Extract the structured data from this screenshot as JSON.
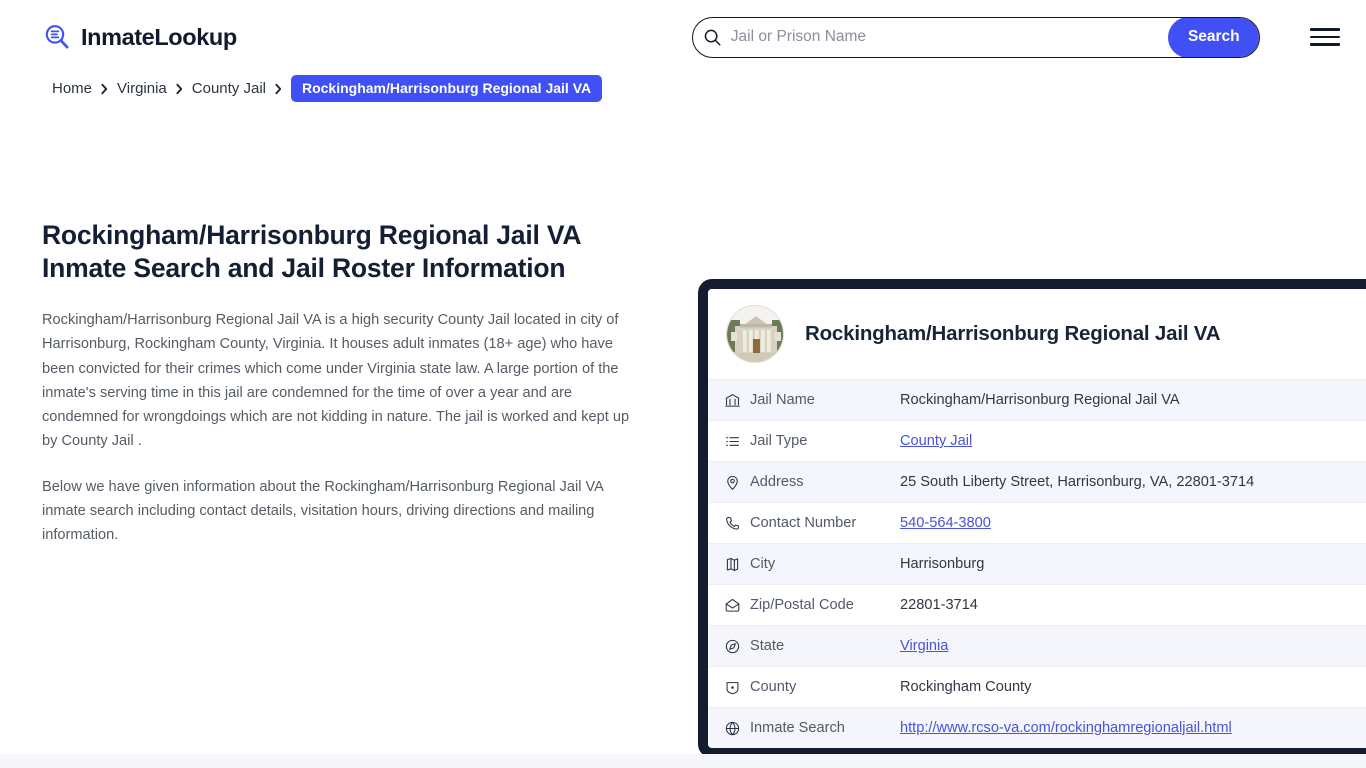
{
  "header": {
    "brand_name": "InmateLookup",
    "brand_icon": "magnifier-list-logo-icon",
    "search": {
      "placeholder": "Jail or Prison Name",
      "value": "",
      "icon": "search-icon",
      "button_label": "Search"
    },
    "menu_icon": "hamburger-menu-icon",
    "accent_color": "#4050f5"
  },
  "breadcrumb": {
    "items": [
      {
        "label": "Home",
        "current": false
      },
      {
        "label": "Virginia",
        "current": false
      },
      {
        "label": "County Jail",
        "current": false
      },
      {
        "label": "Rockingham/Harrisonburg Regional Jail VA",
        "current": true
      }
    ],
    "separator_icon": "chevron-right-icon"
  },
  "main": {
    "page_title": "Rockingham/Harrisonburg Regional Jail VA Inmate Search and Jail Roster Information",
    "paragraph_1": "Rockingham/Harrisonburg Regional Jail VA is a high security County Jail located in city of Harrisonburg, Rockingham County, Virginia. It houses adult inmates (18+ age) who have been convicted for their crimes which come under Virginia state law. A large portion of the inmate's serving time in this jail are condemned for the time of over a year and are condemned for wrongdoings which are not kidding in nature. The jail is worked and kept up by County Jail .",
    "paragraph_2": "Below we have given information about the Rockingham/Harrisonburg Regional Jail VA inmate search including contact details, visitation hours, driving directions and mailing information."
  },
  "card": {
    "photo_icon": "courthouse-building-photo",
    "title": "Rockingham/Harrisonburg Regional Jail VA",
    "border_color": "#141d2f",
    "rows": [
      {
        "icon": "bank-building-icon",
        "label": "Jail Name",
        "value": "Rockingham/Harrisonburg Regional Jail VA",
        "link": false
      },
      {
        "icon": "list-icon",
        "label": "Jail Type",
        "value": "County Jail",
        "link": true
      },
      {
        "icon": "map-pin-icon",
        "label": "Address",
        "value": "25 South Liberty Street, Harrisonburg, VA, 22801-3714",
        "link": false
      },
      {
        "icon": "phone-icon",
        "label": "Contact Number",
        "value": "540-564-3800",
        "link": true
      },
      {
        "icon": "map-icon",
        "label": "City",
        "value": "Harrisonburg",
        "link": false
      },
      {
        "icon": "open-envelope-icon",
        "label": "Zip/Postal Code",
        "value": "22801-3714",
        "link": false
      },
      {
        "icon": "compass-globe-icon",
        "label": "State",
        "value": "Virginia",
        "link": true
      },
      {
        "icon": "county-badge-icon",
        "label": "County",
        "value": "Rockingham County",
        "link": false
      },
      {
        "icon": "globe-icon",
        "label": "Inmate Search",
        "value": "http://www.rcso-va.com/rockinghamregionaljail.html",
        "link": true
      }
    ]
  }
}
